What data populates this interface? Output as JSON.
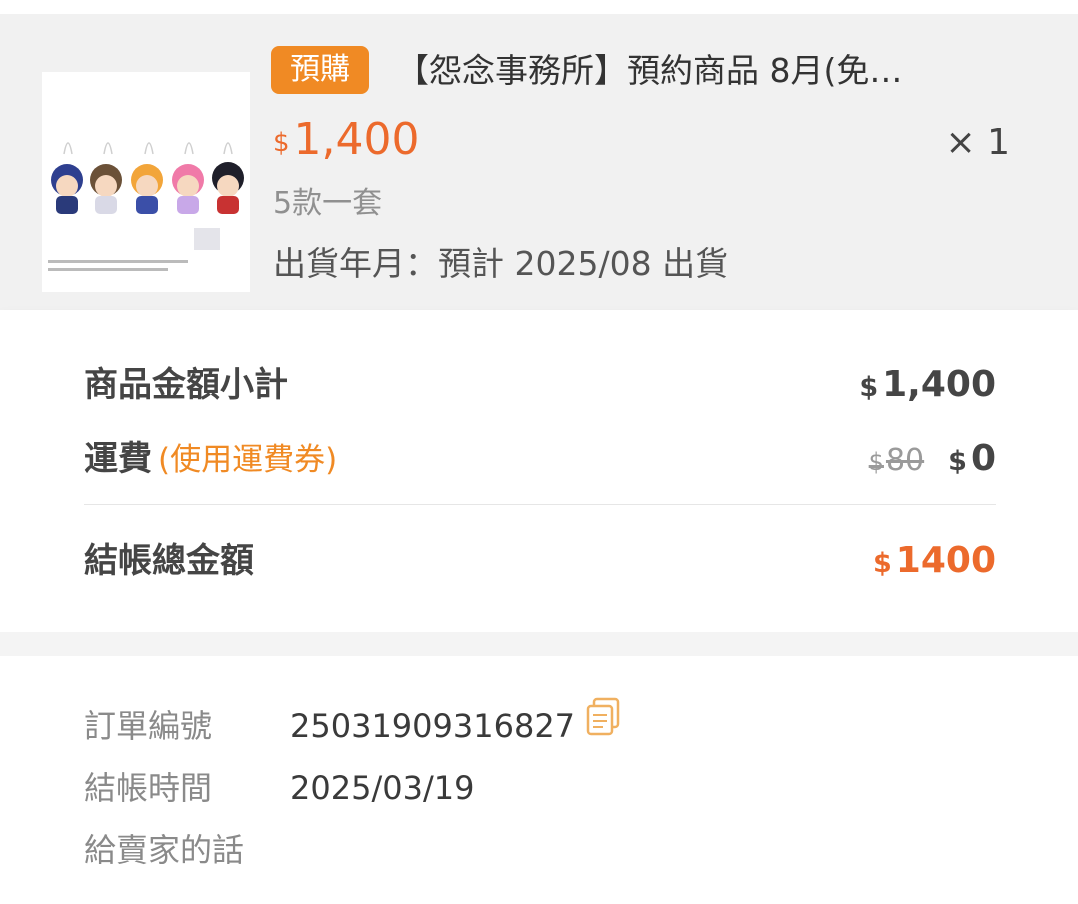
{
  "item": {
    "tag": "預購",
    "title": "【怨念事務所】預約商品 8月(免…",
    "price_currency": "$",
    "price": "1,400",
    "quantity": "× 1",
    "variant": "5款一套",
    "ship_date": "出貨年月：預計 2025/08 出貨"
  },
  "summary": {
    "subtotal_label": "商品金額小計",
    "subtotal_currency": "$",
    "subtotal_value": "1,400",
    "shipping_label": "運費",
    "shipping_note": "(使用運費券)",
    "shipping_original_currency": "$",
    "shipping_original": "80",
    "shipping_currency": "$",
    "shipping_value": "0",
    "total_label": "結帳總金額",
    "total_currency": "$",
    "total_value": "1400"
  },
  "order_info": {
    "order_no_label": "訂單編號",
    "order_no": "25031909316827",
    "checkout_time_label": "結帳時間",
    "checkout_time": "2025/03/19",
    "message_label": "給賣家的話"
  },
  "colors": {
    "accent": "#ec6a2c",
    "tag_bg": "#f08a24",
    "card_bg": "#f1f1f1"
  }
}
